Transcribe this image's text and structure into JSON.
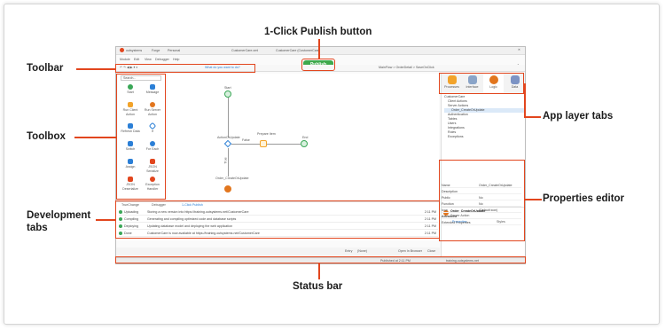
{
  "callouts": {
    "publish": "1-Click Publish button",
    "toolbar": "Toolbar",
    "toolbox": "Toolbox",
    "development_tabs": "Development tabs",
    "app_layer_tabs": "App layer tabs",
    "properties_editor": "Properties editor",
    "status_bar": "Status bar"
  },
  "app": {
    "brand": "outsystems",
    "window_tabs": [
      "Forge",
      "Personal",
      "CustomerCare.oml",
      "CustomerCare (CustomerCare)"
    ],
    "menu": [
      "Module",
      "Edit",
      "View",
      "Debugger",
      "Help"
    ],
    "toolbar_hint": "What do you want to do?",
    "breadcrumb": "MainFlow > OrderDetail > SaveOnClick",
    "publish_label": "Publish",
    "toolbox_search": "Search...",
    "toolbox_items": [
      "Start",
      "Message",
      "Run Client Action",
      "Run Server Action",
      "Refresh Data",
      "If",
      "Switch",
      "For Each",
      "Assign",
      "JSON Serialize",
      "JSON Deserialize",
      "Exception Handler"
    ],
    "flow": {
      "start": "Start",
      "if_label": "ActionOrUpdate",
      "false_label": "False",
      "true_label": "True",
      "prepare": "Prepare Item",
      "end": "End",
      "update": "Order_CreateOrUpdate"
    },
    "layer_tabs": [
      "Processes",
      "Interface",
      "Logic",
      "Data"
    ],
    "tree": [
      "CustomerCare",
      "Client Actions",
      "Server Actions",
      "Order_CreateOrUpdate",
      "Authentication",
      "Tables",
      "Users",
      "Integrations",
      "Roles",
      "Exceptions"
    ],
    "properties": {
      "title": "Order_CreateOrUpdate",
      "subtitle": "Server Action",
      "tab_properties": "Properties",
      "tab_styles": "Styles",
      "rows": [
        {
          "label": "Name",
          "value": "Order_CreateOrUpdate"
        },
        {
          "label": "Description",
          "value": ""
        },
        {
          "label": "Public",
          "value": "No"
        },
        {
          "label": "Function",
          "value": "No"
        },
        {
          "label": "Icon",
          "value": "(Default icon)"
        },
        {
          "label": "Advanced",
          "value": ""
        },
        {
          "label": "Extended Properties",
          "value": ""
        }
      ]
    },
    "dev_tabs": [
      "TrueChange",
      "Debugger",
      "1-Click Publish"
    ],
    "dev_rows": [
      {
        "status": "Uploading",
        "message": "Storing a new version into https://training.outsystems.net/CustomerCare",
        "time": "2:11 PM"
      },
      {
        "status": "Compiling",
        "message": "Generating and compiling optimized code and database scripts",
        "time": "2:11 PM"
      },
      {
        "status": "Deploying",
        "message": "Updating database model and deploying the web application",
        "time": "2:11 PM"
      },
      {
        "status": "Done",
        "message": "CustomerCare is now available at https://training.outsystems.net/CustomerCare",
        "time": "2:11 PM"
      }
    ],
    "action_bar": {
      "entry": "Entry",
      "entry_value": "(None)",
      "open_browser": "Open In Browser",
      "close": "Close"
    },
    "status_bar": {
      "left": "Published at 2:11 PM",
      "right": "training.outsystems.net"
    }
  },
  "colors": {
    "accent": "#e2461e",
    "publish_green": "#3ea94d",
    "flow_blue": "#2b7fd6"
  }
}
